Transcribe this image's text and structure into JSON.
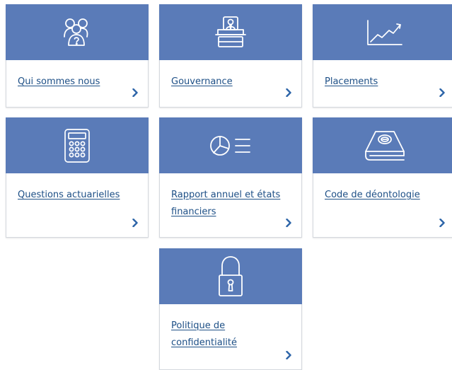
{
  "colors": {
    "banner": "#5a7bb8",
    "link": "#1d4f86",
    "chevron": "#2c64a8",
    "icon": "#ffffff",
    "border": "#d4d8de"
  },
  "tiles": [
    {
      "label": "Qui sommes nous",
      "icon": "group-question-icon"
    },
    {
      "label": "Gouvernance",
      "icon": "podium-speaker-icon"
    },
    {
      "label": "Placements",
      "icon": "growth-chart-icon"
    },
    {
      "label": "Questions actuarielles",
      "icon": "calculator-icon"
    },
    {
      "label": "Rapport annuel et états financiers",
      "icon": "pie-chart-list-icon"
    },
    {
      "label": "Code de déontologie",
      "icon": "book-seal-icon"
    },
    {
      "label": "Politique de confidentialité",
      "icon": "padlock-icon"
    }
  ]
}
